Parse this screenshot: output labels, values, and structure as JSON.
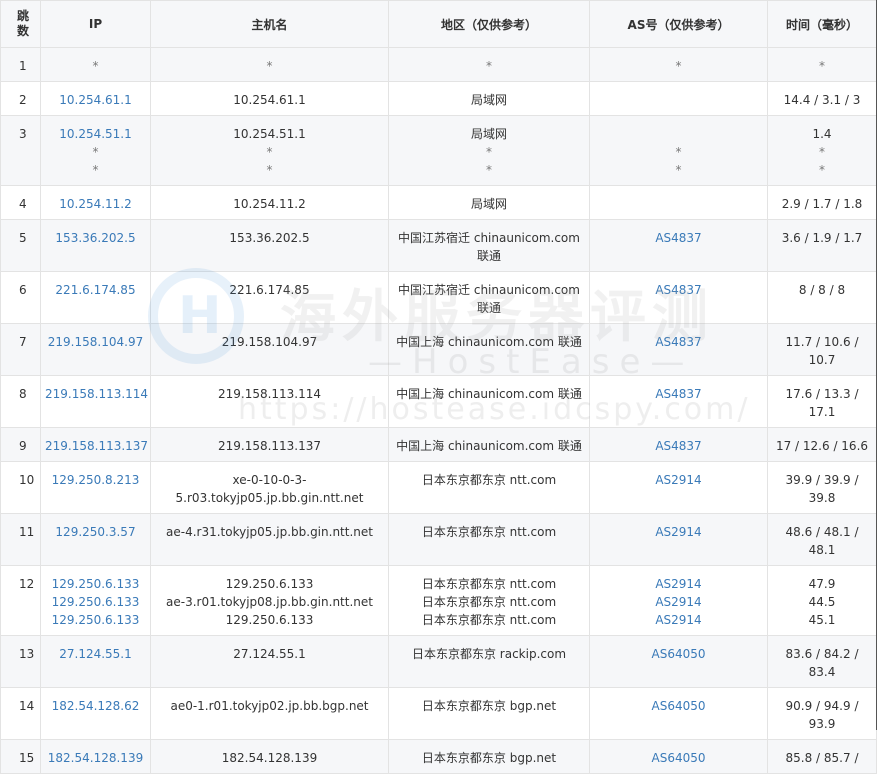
{
  "headers": {
    "hop": "跳\n数",
    "ip": "IP",
    "hostname": "主机名",
    "region": "地区（仅供参考）",
    "as": "AS号（仅供参考）",
    "time": "时间（毫秒）"
  },
  "watermark": {
    "title": "海外服务器评测",
    "subtitle": "—HostEase—",
    "url": "https://hostease.idcspy.com/",
    "logo_letter": "H"
  },
  "colors": {
    "link": "#3a7ab8",
    "header_bg": "#f6f7f9",
    "row_alt_bg": "#f6f7f9",
    "border": "#e3e3e3"
  },
  "rows": [
    {
      "hop": "1",
      "ip": [
        "*"
      ],
      "host": [
        "*"
      ],
      "region": [
        "*"
      ],
      "as": [
        "*"
      ],
      "time": [
        "*"
      ]
    },
    {
      "hop": "2",
      "ip": [
        "10.254.61.1"
      ],
      "host": [
        "10.254.61.1"
      ],
      "region": [
        "局域网"
      ],
      "as": [
        ""
      ],
      "time": [
        "14.4 / 3.1 / 3"
      ]
    },
    {
      "hop": "3",
      "ip": [
        "10.254.51.1",
        "*",
        "*"
      ],
      "host": [
        "10.254.51.1",
        "*",
        "*"
      ],
      "region": [
        "局域网",
        "*",
        "*"
      ],
      "as": [
        "",
        "*",
        "*"
      ],
      "time": [
        "1.4",
        "*",
        "*"
      ]
    },
    {
      "hop": "4",
      "ip": [
        "10.254.11.2"
      ],
      "host": [
        "10.254.11.2"
      ],
      "region": [
        "局域网"
      ],
      "as": [
        ""
      ],
      "time": [
        "2.9 / 1.7 / 1.8"
      ]
    },
    {
      "hop": "5",
      "ip": [
        "153.36.202.5"
      ],
      "host": [
        "153.36.202.5"
      ],
      "region": [
        "中国江苏宿迁 chinaunicom.com 联通"
      ],
      "as": [
        "AS4837"
      ],
      "time": [
        "3.6 / 1.9 / 1.7"
      ]
    },
    {
      "hop": "6",
      "ip": [
        "221.6.174.85"
      ],
      "host": [
        "221.6.174.85"
      ],
      "region": [
        "中国江苏宿迁 chinaunicom.com 联通"
      ],
      "as": [
        "AS4837"
      ],
      "time": [
        "8 / 8 / 8"
      ]
    },
    {
      "hop": "7",
      "ip": [
        "219.158.104.97"
      ],
      "host": [
        "219.158.104.97"
      ],
      "region": [
        "中国上海 chinaunicom.com 联通"
      ],
      "as": [
        "AS4837"
      ],
      "time": [
        "11.7 / 10.6 / 10.7"
      ]
    },
    {
      "hop": "8",
      "ip": [
        "219.158.113.114"
      ],
      "host": [
        "219.158.113.114"
      ],
      "region": [
        "中国上海 chinaunicom.com 联通"
      ],
      "as": [
        "AS4837"
      ],
      "time": [
        "17.6 / 13.3 / 17.1"
      ]
    },
    {
      "hop": "9",
      "ip": [
        "219.158.113.137"
      ],
      "host": [
        "219.158.113.137"
      ],
      "region": [
        "中国上海 chinaunicom.com 联通"
      ],
      "as": [
        "AS4837"
      ],
      "time": [
        "17 / 12.6 / 16.6"
      ]
    },
    {
      "hop": "10",
      "ip": [
        "129.250.8.213"
      ],
      "host": [
        "xe-0-10-0-3-5.r03.tokyjp05.jp.bb.gin.ntt.net"
      ],
      "region": [
        "日本东京都东京 ntt.com"
      ],
      "as": [
        "AS2914"
      ],
      "time": [
        "39.9 / 39.9 / 39.8"
      ]
    },
    {
      "hop": "11",
      "ip": [
        "129.250.3.57"
      ],
      "host": [
        "ae-4.r31.tokyjp05.jp.bb.gin.ntt.net"
      ],
      "region": [
        "日本东京都东京 ntt.com"
      ],
      "as": [
        "AS2914"
      ],
      "time": [
        "48.6 / 48.1 / 48.1"
      ]
    },
    {
      "hop": "12",
      "ip": [
        "129.250.6.133",
        "129.250.6.133",
        "129.250.6.133"
      ],
      "host": [
        "129.250.6.133",
        "ae-3.r01.tokyjp08.jp.bb.gin.ntt.net",
        "129.250.6.133"
      ],
      "region": [
        "日本东京都东京 ntt.com",
        "日本东京都东京 ntt.com",
        "日本东京都东京 ntt.com"
      ],
      "as": [
        "AS2914",
        "AS2914",
        "AS2914"
      ],
      "time": [
        "47.9",
        "44.5",
        "45.1"
      ]
    },
    {
      "hop": "13",
      "ip": [
        "27.124.55.1"
      ],
      "host": [
        "27.124.55.1"
      ],
      "region": [
        "日本东京都东京 rackip.com"
      ],
      "as": [
        "AS64050"
      ],
      "time": [
        "83.6 / 84.2 / 83.4"
      ]
    },
    {
      "hop": "14",
      "ip": [
        "182.54.128.62"
      ],
      "host": [
        "ae0-1.r01.tokyjp02.jp.bb.bgp.net"
      ],
      "region": [
        "日本东京都东京 bgp.net"
      ],
      "as": [
        "AS64050"
      ],
      "time": [
        "90.9 / 94.9 / 93.9"
      ]
    },
    {
      "hop": "15",
      "ip": [
        "182.54.128.139"
      ],
      "host": [
        "182.54.128.139"
      ],
      "region": [
        "日本东京都东京 bgp.net"
      ],
      "as": [
        "AS64050"
      ],
      "time": [
        "85.8 / 85.7 /"
      ]
    }
  ]
}
